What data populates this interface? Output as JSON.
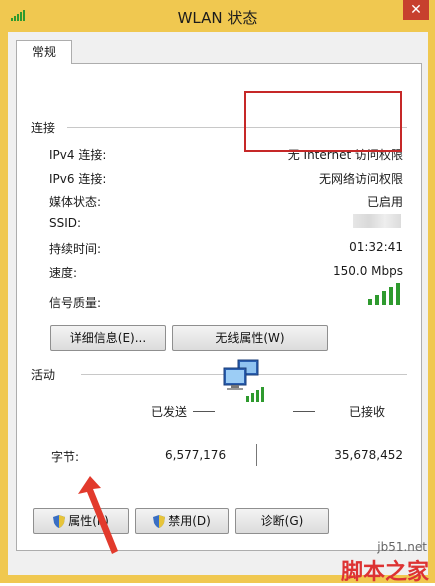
{
  "window": {
    "title": "WLAN 状态",
    "close_glyph": "✕"
  },
  "tabs": [
    {
      "label": "常规"
    }
  ],
  "connection": {
    "group_title": "连接",
    "rows": [
      {
        "label": "IPv4 连接:",
        "value": "无 Internet 访问权限"
      },
      {
        "label": "IPv6 连接:",
        "value": "无网络访问权限"
      },
      {
        "label": "媒体状态:",
        "value": "已启用"
      },
      {
        "label": "SSID:",
        "value": ""
      },
      {
        "label": "持续时间:",
        "value": "01:32:41"
      },
      {
        "label": "速度:",
        "value": "150.0 Mbps"
      },
      {
        "label": "信号质量:",
        "value": ""
      }
    ],
    "signal_bars": 5
  },
  "buttons_mid": {
    "details": "详细信息(E)...",
    "wireless_props": "无线属性(W)"
  },
  "activity": {
    "group_title": "活动",
    "sent_label": "已发送",
    "received_label": "已接收",
    "bytes_label": "字节:",
    "bytes_sent": "6,577,176",
    "bytes_received": "35,678,452"
  },
  "buttons_bottom": {
    "properties": "属性(P)",
    "disable": "禁用(D)",
    "diagnose": "诊断(G)"
  },
  "watermark": {
    "site": "jb51.net",
    "name": "脚本之家"
  },
  "colors": {
    "titlebar": "#f0c850",
    "close": "#c7402e",
    "highlight": "#c62828",
    "signal": "#2e9a2e"
  }
}
